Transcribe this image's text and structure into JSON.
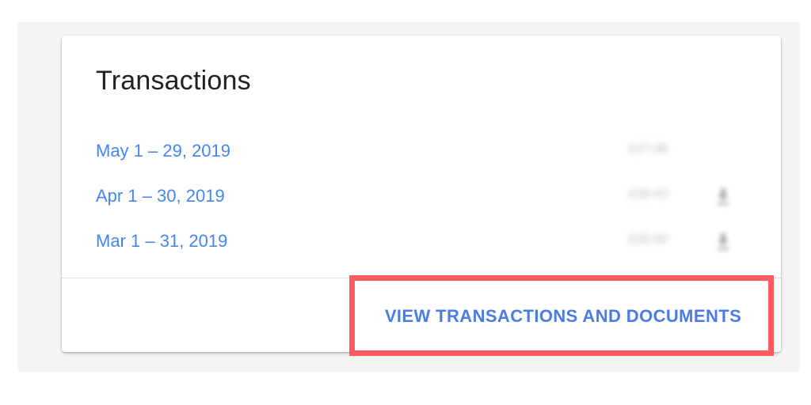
{
  "card": {
    "title": "Transactions",
    "rows": [
      {
        "period": "May 1 – 29, 2019",
        "amount": "£27.06",
        "has_download": false
      },
      {
        "period": "Apr 1 – 30, 2019",
        "amount": "£38.43",
        "has_download": true
      },
      {
        "period": "Mar 1 – 31, 2019",
        "amount": "£35.60",
        "has_download": true
      }
    ],
    "action_label": "VIEW TRANSACTIONS AND DOCUMENTS"
  },
  "icons": {
    "download": "download-icon"
  },
  "colors": {
    "link": "#4285f4",
    "action": "#4a7ce6",
    "highlight": "#ff5a5f",
    "title": "#212121"
  }
}
